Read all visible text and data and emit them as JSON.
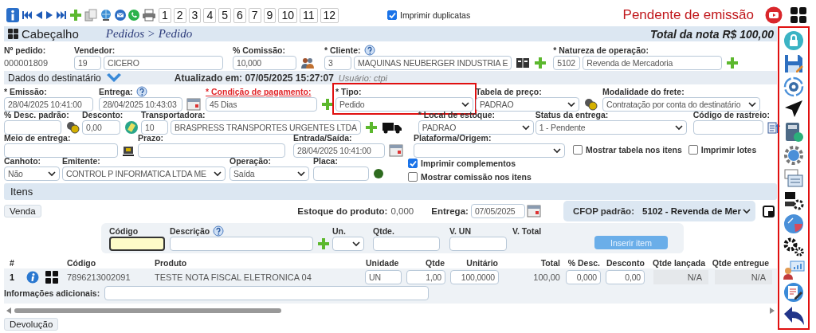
{
  "toolbar": {
    "pages": [
      "1",
      "2",
      "3",
      "4",
      "5",
      "6",
      "7",
      "9",
      "10",
      "11",
      "12"
    ],
    "print_duplicates": {
      "label": "Imprimir duplicatas",
      "checked": true
    },
    "status": "Pendente de emissão"
  },
  "header": {
    "title": "Cabeçalho",
    "breadcrumb": "Pedidos > Pedido",
    "total": "Total da nota R$ 100,00"
  },
  "recipient_bar": {
    "label": "Dados do destinatário",
    "updated": "Atualizado em: 07/05/2025 15:27:07",
    "user": "Usuário: ctpi"
  },
  "rows": [
    [
      {
        "kind": "text",
        "label": "Nº pedido:",
        "value": "000001809"
      },
      {
        "kind": "code_name",
        "label": "Vendedor:",
        "code": "19",
        "name": "CICERO"
      },
      {
        "kind": "input",
        "label": "% Comissão:",
        "value": "10,000"
      },
      {
        "kind": "code_name",
        "label": "* Cliente:",
        "help": true,
        "code": "3",
        "name": "MAQUINAS NEUBERGER INDUSTRIA E"
      },
      {
        "kind": "code_name",
        "label": "* Natureza de operação:",
        "code": "5102",
        "name": "Revenda de Mercadoria"
      }
    ],
    [
      {
        "kind": "input",
        "label": "* Emissão:",
        "value": "28/04/2025 10:41:00"
      },
      {
        "kind": "input",
        "label": "Entrega:",
        "help": true,
        "value": "28/04/2025 10:43:03"
      },
      {
        "kind": "input",
        "label": "* Condição de pagamento:",
        "alert": true,
        "value": "45 Dias"
      },
      {
        "kind": "select",
        "label": "* Tipo:",
        "outlined": true,
        "value": "Pedido"
      },
      {
        "kind": "select",
        "label": "Tabela de preço:",
        "value": "PADRAO"
      },
      {
        "kind": "select",
        "label": "Modalidade do frete:",
        "value": "Contratação por conta do destinatário"
      }
    ],
    [
      {
        "kind": "input",
        "label": "% Desc. padrão:"
      },
      {
        "kind": "input",
        "label": "Desconto:",
        "value": "0,00"
      },
      {
        "kind": "code_name",
        "label": "Transportadora:",
        "code": "10",
        "name": "BRASPRESS TRANSPORTES URGENTES LTDA"
      },
      {
        "kind": "select",
        "label": "* Local de estoque:",
        "value": "PADRAO"
      },
      {
        "kind": "select",
        "label": "Status da entrega:",
        "value": "1 - Pendente"
      },
      {
        "kind": "input",
        "label": "Código de rastreio:"
      }
    ],
    [
      {
        "kind": "input",
        "label": "Meio de entrega:"
      },
      {
        "kind": "input",
        "label": "Prazo:"
      },
      {
        "kind": "input",
        "label": "Entrada/Saída:",
        "value": "28/04/2025 10:41:00"
      },
      {
        "kind": "select",
        "label": "Plataforma/Origem:"
      },
      {
        "kind": "checks_row",
        "items": [
          {
            "label": "Mostrar tabela nos itens",
            "checked": false
          },
          {
            "label": "Imprimir lotes",
            "checked": false
          }
        ]
      }
    ],
    [
      {
        "kind": "select",
        "label": "Canhoto:",
        "value": "Não"
      },
      {
        "kind": "select",
        "label": "Emitente:",
        "value": "CONTROL P INFORMATICA LTDA ME"
      },
      {
        "kind": "select",
        "label": "Operação:",
        "value": "Saída"
      },
      {
        "kind": "input",
        "label": "Placa:"
      },
      {
        "kind": "checks_column",
        "items": [
          {
            "label": "Imprimir complementos",
            "checked": true
          },
          {
            "label": "Mostrar comissão nos itens",
            "checked": false
          }
        ]
      }
    ]
  ],
  "items": {
    "title": "Itens",
    "sale_button": "Venda",
    "stock_label": "Estoque do produto:",
    "stock_value": "0,000",
    "delivery_label": "Entrega:",
    "delivery_value": "07/05/2025",
    "cfop_label": "CFOP padrão:",
    "cfop_value": "5102 - Revenda de Mer",
    "entry_fields": [
      {
        "label": "Código",
        "kind": "input"
      },
      {
        "label": "Descrição",
        "kind": "input",
        "help": true
      },
      {
        "label": "Un.",
        "kind": "select"
      },
      {
        "label": "Qtde.",
        "kind": "input"
      },
      {
        "label": "V. UN",
        "kind": "input"
      },
      {
        "label": "V. Total",
        "kind": "label"
      }
    ],
    "insert_button": "Inserir item",
    "columns": [
      "#",
      "Código",
      "Produto",
      "Unidade",
      "Qtde",
      "Unitário",
      "Total",
      "% Desc.",
      "Desconto",
      "Qtde lançada",
      "Qtde entregue"
    ],
    "rows": [
      {
        "index": "1",
        "code": "7896213002091",
        "product": "TESTE NOTA FISCAL ELETRONICA 04",
        "unit": "UN",
        "qty": "1,00",
        "unit_price": "100,0000",
        "total": "100,00",
        "discount_pct": "0,000",
        "discount": "0,00",
        "qty_posted": "N/A",
        "qty_delivered": "N/A",
        "extra_label": "Informações adicionais:"
      }
    ],
    "return_button": "Devolução"
  }
}
